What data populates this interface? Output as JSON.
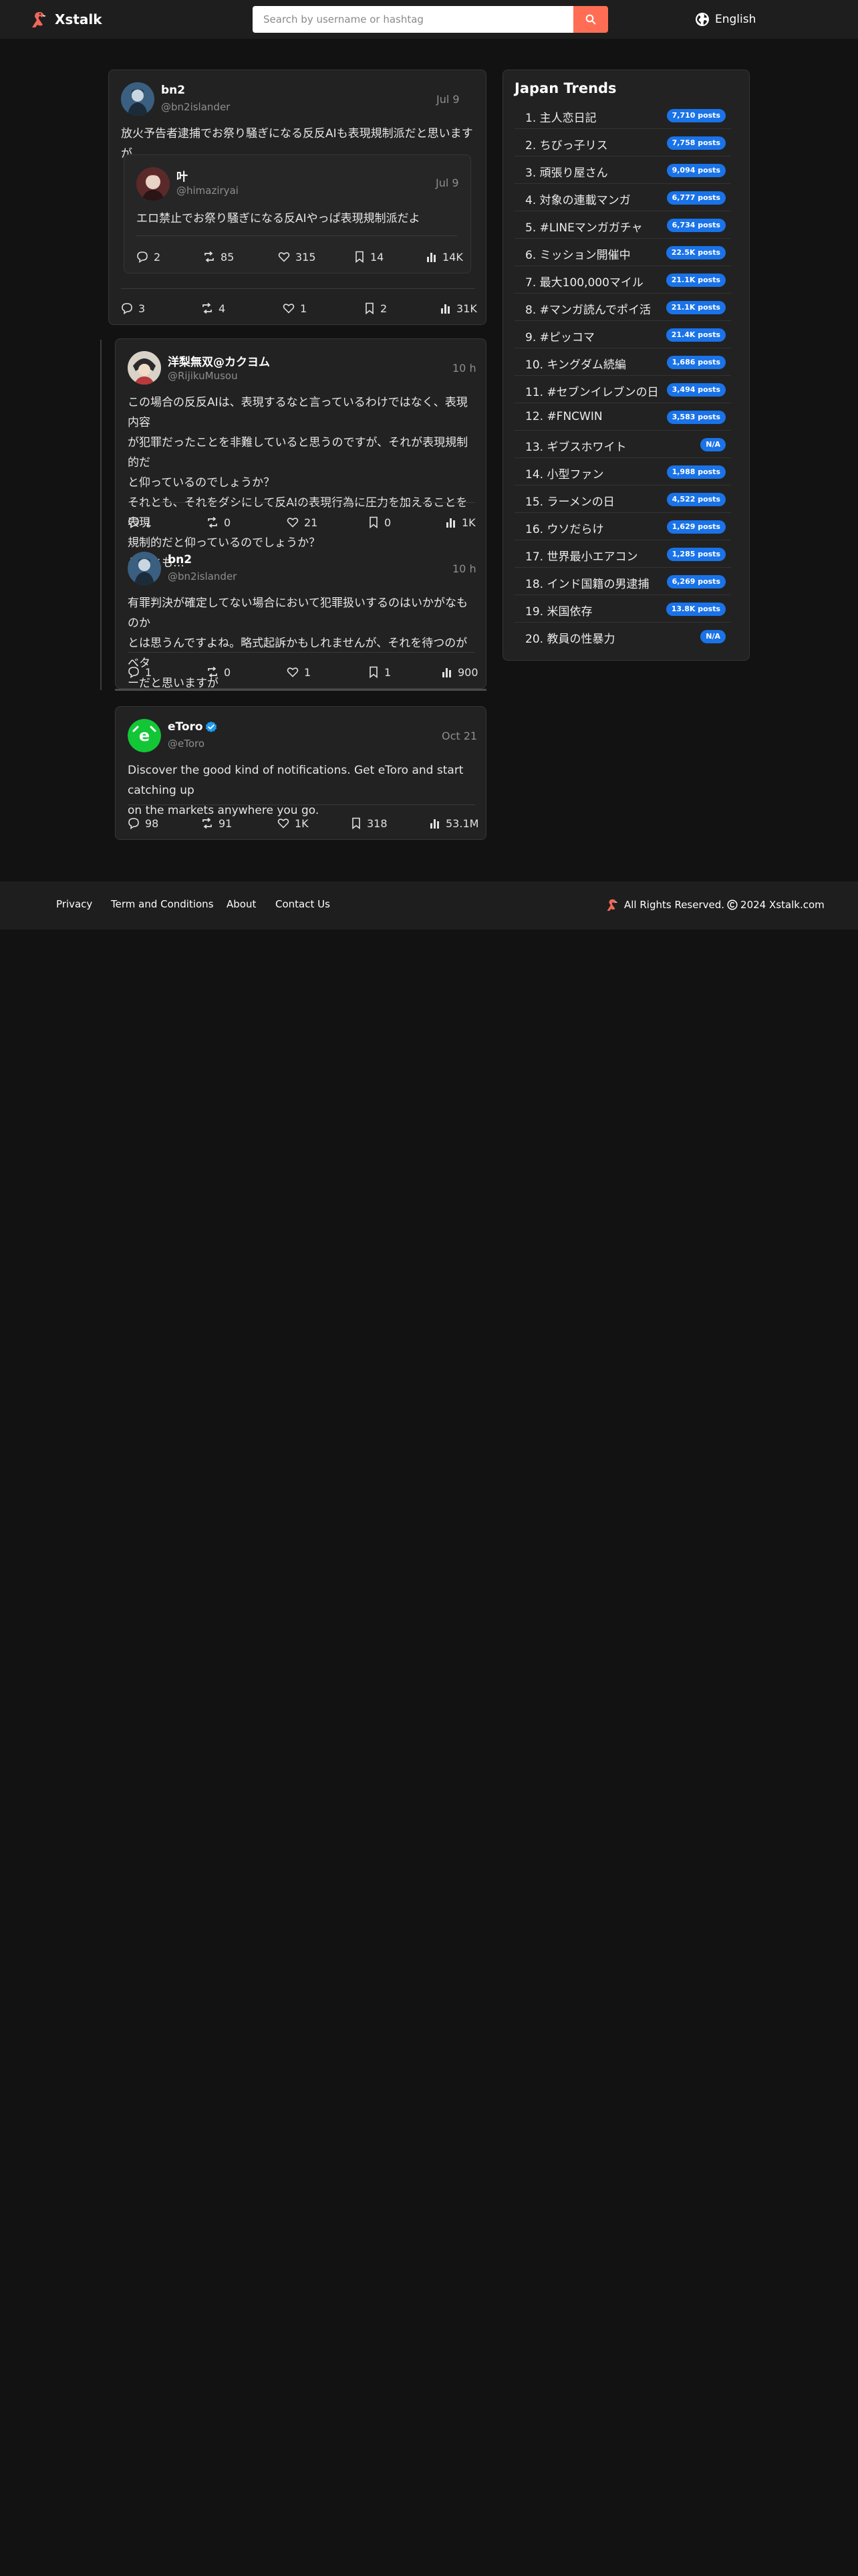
{
  "nav": {
    "brand": "Xstalk",
    "search_placeholder": "Search by username or hashtag",
    "language": "English"
  },
  "posts": [
    {
      "display_name": "bn2",
      "username": "@bn2islander",
      "time": "Jul 9",
      "text": "放火予告者逮捕でお祭り騒ぎになる反反AIも表現規制派だと思いますが",
      "quote": {
        "display_name": "叶",
        "username": "@himaziryai",
        "time": "Jul 9",
        "text": "エロ禁止でお祭り騒ぎになる反AIやっぱ表現規制派だよ",
        "stats": {
          "replies": "2",
          "reposts": "85",
          "likes": "315",
          "bookmarks": "14",
          "views": "14K"
        }
      },
      "stats": {
        "replies": "3",
        "reposts": "4",
        "likes": "1",
        "bookmarks": "2",
        "views": "31K"
      }
    },
    {
      "display_name": "洋梨無双@カクヨム",
      "username": "@RijikuMusou",
      "time": "10 h",
      "text": "この場合の反反AIは、表現するなと言っているわけではなく、表現内容\nが犯罪だったことを非難していると思うのですが、それが表現規制的だ\nと仰っているのでしょうか？\nそれとも、それをダシにして反AIの表現行為に圧力を加えることを表現\n規制的だと仰っているのでしょうか？\nそれとも…",
      "stats": {
        "replies": "1",
        "reposts": "0",
        "likes": "21",
        "bookmarks": "0",
        "views": "1K"
      }
    },
    {
      "display_name": "bn2",
      "username": "@bn2islander",
      "time": "10 h",
      "text": "有罪判決が確定してない場合において犯罪扱いするのはいかがなものか\nとは思うんですよね。略式起訴かもしれませんが、それを待つのがベタ\nーだと思いますが",
      "stats": {
        "replies": "1",
        "reposts": "0",
        "likes": "1",
        "bookmarks": "1",
        "views": "900"
      }
    },
    {
      "display_name": "eToro",
      "username": "@eToro",
      "time": "Oct 21",
      "text": "Discover the good kind of notifications. Get eToro and start catching up\non the markets anywhere you go.",
      "stats": {
        "replies": "98",
        "reposts": "91",
        "likes": "1K",
        "bookmarks": "318",
        "views": "53.1M"
      }
    }
  ],
  "trends": {
    "title": "Japan Trends",
    "items": [
      {
        "label": "1. 主人恋日記",
        "count": "7,710 posts"
      },
      {
        "label": "2. ちびっ子リス",
        "count": "7,758 posts"
      },
      {
        "label": "3. 頑張り屋さん",
        "count": "9,094 posts"
      },
      {
        "label": "4. 対象の連載マンガ",
        "count": "6,777 posts"
      },
      {
        "label": "5. #LINEマンガガチャ",
        "count": "6,734 posts"
      },
      {
        "label": "6. ミッション開催中",
        "count": "22.5K posts"
      },
      {
        "label": "7. 最大100,000マイル",
        "count": "21.1K posts"
      },
      {
        "label": "8. #マンガ読んでポイ活",
        "count": "21.1K posts"
      },
      {
        "label": "9. #ピッコマ",
        "count": "21.4K posts"
      },
      {
        "label": "10. キングダム続編",
        "count": "1,686 posts"
      },
      {
        "label": "11. #セブンイレブンの日",
        "count": "3,494 posts"
      },
      {
        "label": "12. #FNCWIN",
        "count": "3,583 posts"
      },
      {
        "label": "13. ギブスホワイト",
        "count": "N/A"
      },
      {
        "label": "14. 小型ファン",
        "count": "1,988 posts"
      },
      {
        "label": "15. ラーメンの日",
        "count": "4,522 posts"
      },
      {
        "label": "16. ウソだらけ",
        "count": "1,629 posts"
      },
      {
        "label": "17. 世界最小エアコン",
        "count": "1,285 posts"
      },
      {
        "label": "18. インド国籍の男逮捕",
        "count": "6,269 posts"
      },
      {
        "label": "19. 米国依存",
        "count": "13.8K posts"
      },
      {
        "label": "20. 教員の性暴力",
        "count": "N/A"
      }
    ]
  },
  "footer": {
    "links": [
      "Privacy",
      "Term and Conditions",
      "About",
      "Contact Us"
    ],
    "copyright_prefix": "All Rights Reserved.",
    "copyright_suffix": "2024 Xstalk.com"
  },
  "colors": {
    "background": "#121212",
    "card": "#222222",
    "navbar": "#1e1e1e",
    "accent": "#ff6e54",
    "badge": "#1a73e8",
    "etoro_green": "#13c636"
  }
}
